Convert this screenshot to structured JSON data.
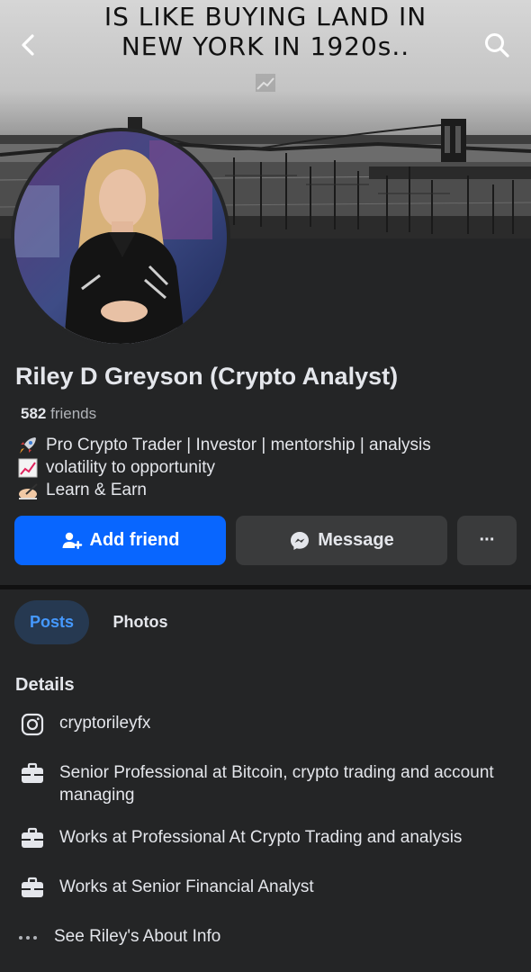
{
  "cover": {
    "line1": "IS LIKE BUYING LAND IN",
    "line2": "NEW YORK IN 1920s.."
  },
  "profile": {
    "name": "Riley D Greyson (Crypto Analyst)",
    "friends_count": "582",
    "friends_label": "friends",
    "bio": [
      {
        "icon": "rocket-icon",
        "text": "Pro Crypto Trader | Investor | mentorship | analysis"
      },
      {
        "icon": "chart-increasing-icon",
        "text": "volatility to opportunity"
      },
      {
        "icon": "writing-hand-icon",
        "text": "Learn & Earn"
      }
    ]
  },
  "actions": {
    "add_friend": "Add friend",
    "message": "Message",
    "more": "···"
  },
  "tabs": {
    "posts": "Posts",
    "photos": "Photos"
  },
  "details": {
    "title": "Details",
    "items": [
      {
        "icon": "instagram-icon",
        "text": "cryptorileyfx"
      },
      {
        "icon": "briefcase-icon",
        "text": "Senior Professional at Bitcoin, crypto trading and account managing"
      },
      {
        "icon": "briefcase-icon",
        "text": "Works at Professional At Crypto Trading and analysis"
      },
      {
        "icon": "briefcase-icon",
        "text": "Works at Senior Financial Analyst"
      }
    ],
    "see_about": "See Riley's About Info"
  },
  "colors": {
    "background": "#242526",
    "primary_button": "#0866ff",
    "secondary_button": "#3a3b3c",
    "active_tab_bg": "#263951",
    "active_tab_text": "#4599ff"
  }
}
